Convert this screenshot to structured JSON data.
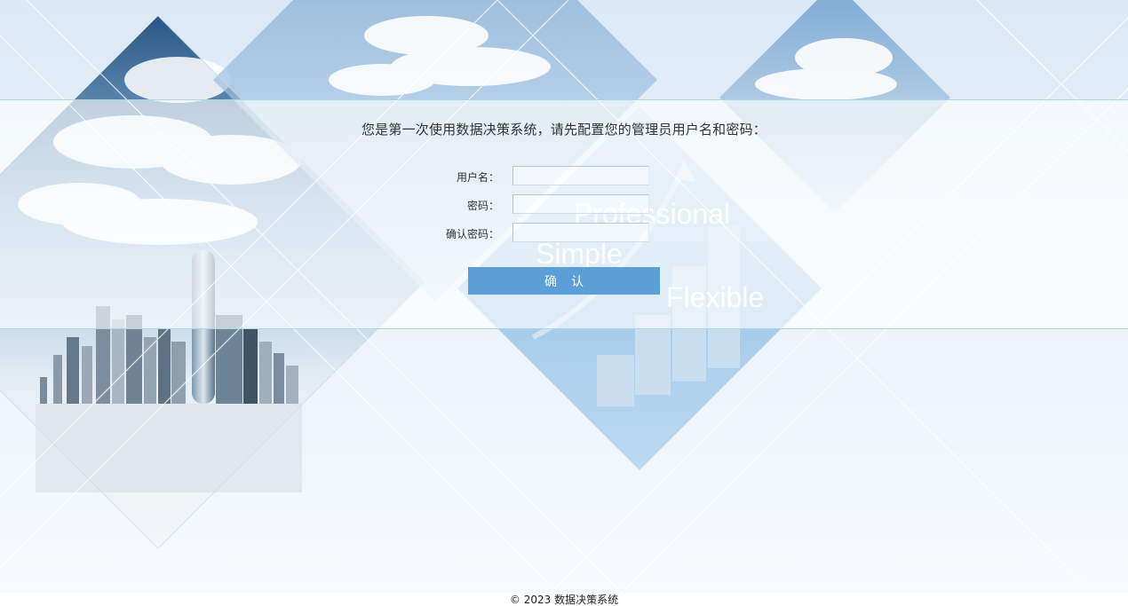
{
  "background": {
    "words": [
      "Professional",
      "Simple",
      "Flexible"
    ]
  },
  "setup": {
    "prompt": "您是第一次使用数据决策系统，请先配置您的管理员用户名和密码：",
    "username_label": "用户名：",
    "username_value": "",
    "password_label": "密码：",
    "password_value": "",
    "confirm_password_label": "确认密码：",
    "confirm_password_value": "",
    "confirm_button": "确认"
  },
  "footer": {
    "copyright": "© 2023 数据决策系统"
  },
  "colors": {
    "button": "#5b9fd6",
    "band_border": "#a9d6e8",
    "text": "#333333"
  }
}
